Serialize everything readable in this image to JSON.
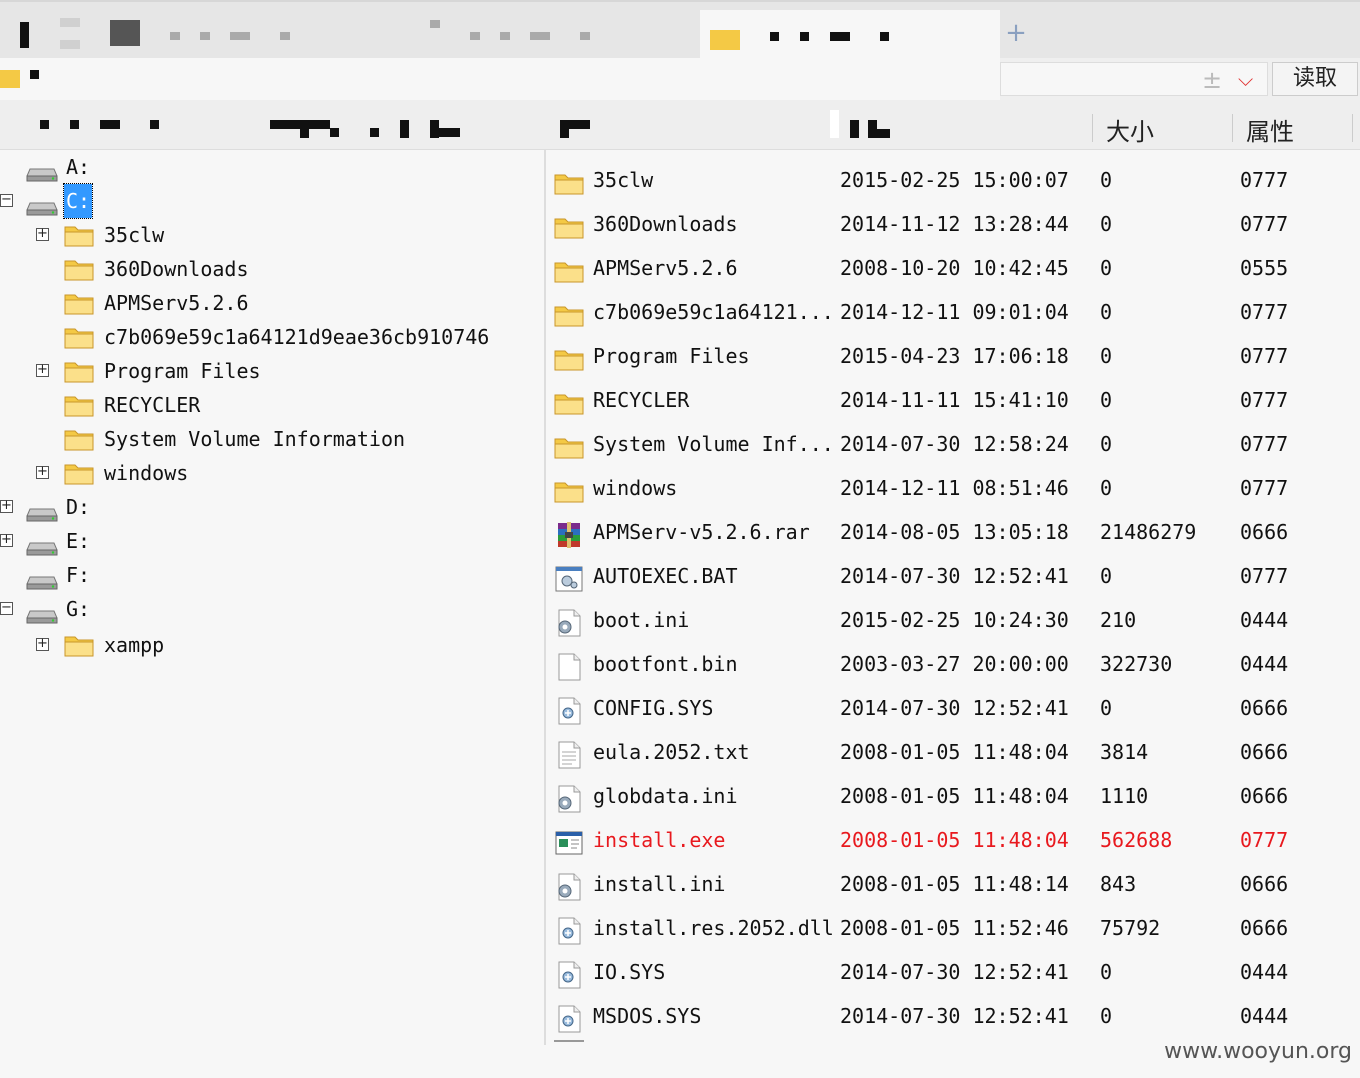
{
  "toolbar": {
    "read_label": "读取"
  },
  "headers": {
    "size": "大小",
    "attr": "属性"
  },
  "tree": [
    {
      "label": "A:",
      "type": "drive",
      "depth": 0,
      "toggle": ""
    },
    {
      "label": "C:",
      "type": "drive",
      "depth": 0,
      "toggle": "−",
      "selected": true
    },
    {
      "label": "35clw",
      "type": "folder",
      "depth": 1,
      "toggle": "+"
    },
    {
      "label": "360Downloads",
      "type": "folder",
      "depth": 1,
      "toggle": ""
    },
    {
      "label": "APMServ5.2.6",
      "type": "folder",
      "depth": 1,
      "toggle": ""
    },
    {
      "label": "c7b069e59c1a64121d9eae36cb910746",
      "type": "folder",
      "depth": 1,
      "toggle": ""
    },
    {
      "label": "Program Files",
      "type": "folder",
      "depth": 1,
      "toggle": "+"
    },
    {
      "label": "RECYCLER",
      "type": "folder",
      "depth": 1,
      "toggle": ""
    },
    {
      "label": "System Volume Information",
      "type": "folder",
      "depth": 1,
      "toggle": ""
    },
    {
      "label": "windows",
      "type": "folder",
      "depth": 1,
      "toggle": "+"
    },
    {
      "label": "D:",
      "type": "drive",
      "depth": 0,
      "toggle": "+"
    },
    {
      "label": "E:",
      "type": "drive",
      "depth": 0,
      "toggle": "+"
    },
    {
      "label": "F:",
      "type": "drive",
      "depth": 0,
      "toggle": ""
    },
    {
      "label": "G:",
      "type": "drive",
      "depth": 0,
      "toggle": "−"
    },
    {
      "label": "xampp",
      "type": "folder",
      "depth": 1,
      "toggle": "+"
    }
  ],
  "files": [
    {
      "name": "35clw",
      "date": "2015-02-25 15:00:07",
      "size": "0",
      "attr": "0777",
      "icon": "folder"
    },
    {
      "name": "360Downloads",
      "date": "2014-11-12 13:28:44",
      "size": "0",
      "attr": "0777",
      "icon": "folder"
    },
    {
      "name": "APMServ5.2.6",
      "date": "2008-10-20 10:42:45",
      "size": "0",
      "attr": "0555",
      "icon": "folder"
    },
    {
      "name": "c7b069e59c1a64121...",
      "date": "2014-12-11 09:01:04",
      "size": "0",
      "attr": "0777",
      "icon": "folder"
    },
    {
      "name": "Program Files",
      "date": "2015-04-23 17:06:18",
      "size": "0",
      "attr": "0777",
      "icon": "folder"
    },
    {
      "name": "RECYCLER",
      "date": "2014-11-11 15:41:10",
      "size": "0",
      "attr": "0777",
      "icon": "folder"
    },
    {
      "name": "System Volume Inf...",
      "date": "2014-07-30 12:58:24",
      "size": "0",
      "attr": "0777",
      "icon": "folder"
    },
    {
      "name": "windows",
      "date": "2014-12-11 08:51:46",
      "size": "0",
      "attr": "0777",
      "icon": "folder"
    },
    {
      "name": "APMServ-v5.2.6.rar",
      "date": "2014-08-05 13:05:18",
      "size": "21486279",
      "attr": "0666",
      "icon": "rar"
    },
    {
      "name": "AUTOEXEC.BAT",
      "date": "2014-07-30 12:52:41",
      "size": "0",
      "attr": "0777",
      "icon": "bat"
    },
    {
      "name": "boot.ini",
      "date": "2015-02-25 10:24:30",
      "size": "210",
      "attr": "0444",
      "icon": "ini"
    },
    {
      "name": "bootfont.bin",
      "date": "2003-03-27 20:00:00",
      "size": "322730",
      "attr": "0444",
      "icon": "blank"
    },
    {
      "name": "CONFIG.SYS",
      "date": "2014-07-30 12:52:41",
      "size": "0",
      "attr": "0666",
      "icon": "sys"
    },
    {
      "name": "eula.2052.txt",
      "date": "2008-01-05 11:48:04",
      "size": "3814",
      "attr": "0666",
      "icon": "txt"
    },
    {
      "name": "globdata.ini",
      "date": "2008-01-05 11:48:04",
      "size": "1110",
      "attr": "0666",
      "icon": "ini"
    },
    {
      "name": "install.exe",
      "date": "2008-01-05 11:48:04",
      "size": "562688",
      "attr": "0777",
      "icon": "exe",
      "highlight": true
    },
    {
      "name": "install.ini",
      "date": "2008-01-05 11:48:14",
      "size": "843",
      "attr": "0666",
      "icon": "ini"
    },
    {
      "name": "install.res.2052.dll",
      "date": "2008-01-05 11:52:46",
      "size": "75792",
      "attr": "0666",
      "icon": "sys"
    },
    {
      "name": "IO.SYS",
      "date": "2014-07-30 12:52:41",
      "size": "0",
      "attr": "0444",
      "icon": "sys"
    },
    {
      "name": "MSDOS.SYS",
      "date": "2014-07-30 12:52:41",
      "size": "0",
      "attr": "0444",
      "icon": "sys"
    }
  ],
  "watermark": "www.wooyun.org",
  "colors": {
    "highlight": "#e8191e",
    "selection": "#3399ff",
    "folder": "#f4c945"
  }
}
